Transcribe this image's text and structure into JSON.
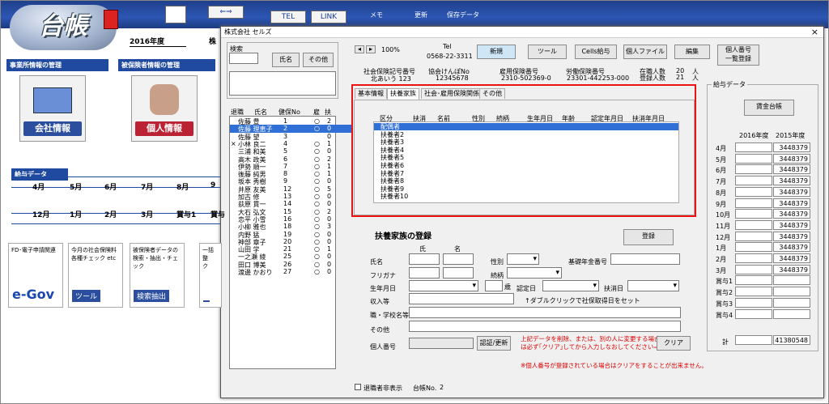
{
  "app": {
    "logo": "台帳",
    "year_label": "処理年度",
    "year_value": "2016年度",
    "proc_label": "処理中の",
    "proc_value": "株",
    "tel": "TEL",
    "link": "LINK",
    "memo": "メモ",
    "update": "更新",
    "save": "保存データ"
  },
  "left": {
    "office_header": "事業所情報の管理",
    "insured_header": "被保険者情報の管理",
    "company_btn": "会社情報",
    "personal_btn": "個人情報",
    "salary_header": "給与データ",
    "months_top": [
      "4月",
      "5月",
      "6月",
      "7月",
      "8月",
      "9"
    ],
    "months_bottom": [
      "12月",
      "1月",
      "2月",
      "3月",
      "賞与1",
      "賞与"
    ],
    "bottom": [
      {
        "line1": "FD･電子申請関連",
        "line2": "",
        "cap": "e-Gov"
      },
      {
        "line1": "今月の社会保険料",
        "line2": "各種チェック etc",
        "cap": "ツール"
      },
      {
        "line1": "被保険者データの",
        "line2": "検索・抽出・チェック",
        "cap": "検索抽出"
      },
      {
        "line1": "一括整",
        "line2": "ク",
        "cap": ""
      }
    ]
  },
  "dialog": {
    "title": "株式会社 セルズ",
    "close": "×",
    "search_label": "検索",
    "name_btn": "氏名",
    "other_btn": "その他",
    "list_headers": [
      "退職",
      "氏名",
      "健保No",
      "雇",
      "扶"
    ],
    "employees": [
      {
        "mark": "",
        "name": "佐藤 豊",
        "no": "1",
        "k": "○",
        "f": "2"
      },
      {
        "mark": "",
        "name": "佐藤 理恵子",
        "no": "2",
        "k": "○",
        "f": "0"
      },
      {
        "mark": "",
        "name": "佐藤 望",
        "no": "3",
        "k": "",
        "f": "0"
      },
      {
        "mark": "×",
        "name": "小林 良二",
        "no": "4",
        "k": "○",
        "f": "1"
      },
      {
        "mark": "",
        "name": "三浦 和美",
        "no": "5",
        "k": "○",
        "f": "0"
      },
      {
        "mark": "",
        "name": "高木 政美",
        "no": "6",
        "k": "○",
        "f": "2"
      },
      {
        "mark": "",
        "name": "伊勢 順一",
        "no": "7",
        "k": "○",
        "f": "1"
      },
      {
        "mark": "",
        "name": "後藤 純男",
        "no": "8",
        "k": "○",
        "f": "1"
      },
      {
        "mark": "",
        "name": "坂本 秀樹",
        "no": "9",
        "k": "○",
        "f": "0"
      },
      {
        "mark": "",
        "name": "井原 友美",
        "no": "12",
        "k": "○",
        "f": "5"
      },
      {
        "mark": "",
        "name": "加古 修",
        "no": "13",
        "k": "○",
        "f": "0"
      },
      {
        "mark": "",
        "name": "荻原 貫一",
        "no": "14",
        "k": "○",
        "f": "0"
      },
      {
        "mark": "",
        "name": "大石 弘文",
        "no": "15",
        "k": "○",
        "f": "2"
      },
      {
        "mark": "",
        "name": "恋平 小雪",
        "no": "16",
        "k": "○",
        "f": "0"
      },
      {
        "mark": "",
        "name": "小柳 雅也",
        "no": "18",
        "k": "○",
        "f": "3"
      },
      {
        "mark": "",
        "name": "内野 猛",
        "no": "19",
        "k": "○",
        "f": "0"
      },
      {
        "mark": "",
        "name": "神部 章子",
        "no": "20",
        "k": "○",
        "f": "0"
      },
      {
        "mark": "",
        "name": "山田 学",
        "no": "21",
        "k": "○",
        "f": "1"
      },
      {
        "mark": "",
        "name": "一之瀬 綾",
        "no": "25",
        "k": "○",
        "f": "0"
      },
      {
        "mark": "",
        "name": "田口 博美",
        "no": "26",
        "k": "○",
        "f": "0"
      },
      {
        "mark": "",
        "name": "渡邊 かおり",
        "no": "27",
        "k": "○",
        "f": "0"
      }
    ],
    "zoom": "100%",
    "tel_label": "Tel",
    "tel_value": "0568-22-3311",
    "buttons": {
      "new": "新規",
      "tool": "ツール",
      "cells": "Cells給与",
      "personal_file": "個人ファイル",
      "edit": "編集",
      "mynumber": "個人番号",
      "mynumber2": "一覧登録"
    },
    "info_labels": [
      "社会保険記号番号",
      "協会けんぽNo",
      "雇用保険番号",
      "労働保険番号",
      "在職人数",
      "登録人数"
    ],
    "info_values": [
      "北あいう 123",
      "12345678",
      "2310-502369-0",
      "23301-442253-000",
      "20",
      "21"
    ],
    "person_unit": "人",
    "tabs": [
      "基本情報",
      "扶養家族",
      "社会･雇用保険関係",
      "その他"
    ],
    "dep_headers": [
      "区分",
      "扶消",
      "名前",
      "性別",
      "続柄",
      "生年月日",
      "年齢",
      "認定年月日",
      "扶消年月日"
    ],
    "dependents": [
      "配偶者",
      "扶養者2",
      "扶養者3",
      "扶養者4",
      "扶養者5",
      "扶養者6",
      "扶養者7",
      "扶養者8",
      "扶養者9",
      "扶養者10"
    ],
    "reg": {
      "title": "扶養家族の登録",
      "register_btn": "登録",
      "sei": "氏",
      "mei": "名",
      "name": "氏名",
      "kana": "フリガナ",
      "sex": "性別",
      "relation": "続柄",
      "pension": "基礎年金番号",
      "birth": "生年月日",
      "age_suffix": "歳",
      "cert_date": "認定日",
      "end_date": "扶消日",
      "income": "収入等",
      "dblclick": "↑ダブルクリックで社保取得日をセット",
      "job": "職・学校名等",
      "other": "その他",
      "mynumber": "個人番号",
      "cert_btn": "認証/更新",
      "warn1": "上記データを削除、または、別の人に変更する場合",
      "warn2": "は必ず｢クリア｣してから入力しなおしてください⇒⇒",
      "clear_btn": "クリア",
      "warn3": "※個人番号が登録されている場合はクリアをすることが出来ません。"
    },
    "salary": {
      "title": "給与データ",
      "ledger_btn": "賃金台帳",
      "y1": "2016年度",
      "y2": "2015年度",
      "rows": [
        {
          "m": "4月",
          "v": "3448379"
        },
        {
          "m": "5月",
          "v": "3448379"
        },
        {
          "m": "6月",
          "v": "3448379"
        },
        {
          "m": "7月",
          "v": "3448379"
        },
        {
          "m": "8月",
          "v": "3448379"
        },
        {
          "m": "9月",
          "v": "3448379"
        },
        {
          "m": "10月",
          "v": "3448379"
        },
        {
          "m": "11月",
          "v": "3448379"
        },
        {
          "m": "12月",
          "v": "3448379"
        },
        {
          "m": "1月",
          "v": "3448379"
        },
        {
          "m": "2月",
          "v": "3448379"
        },
        {
          "m": "3月",
          "v": "3448379"
        },
        {
          "m": "賞与1",
          "v": ""
        },
        {
          "m": "賞与2",
          "v": ""
        },
        {
          "m": "賞与3",
          "v": ""
        },
        {
          "m": "賞与4",
          "v": ""
        }
      ],
      "total_label": "計",
      "total": "41380548"
    },
    "footer": {
      "retired": "退職者非表示",
      "ledger_no_label": "台帳No.",
      "ledger_no": "2"
    }
  }
}
